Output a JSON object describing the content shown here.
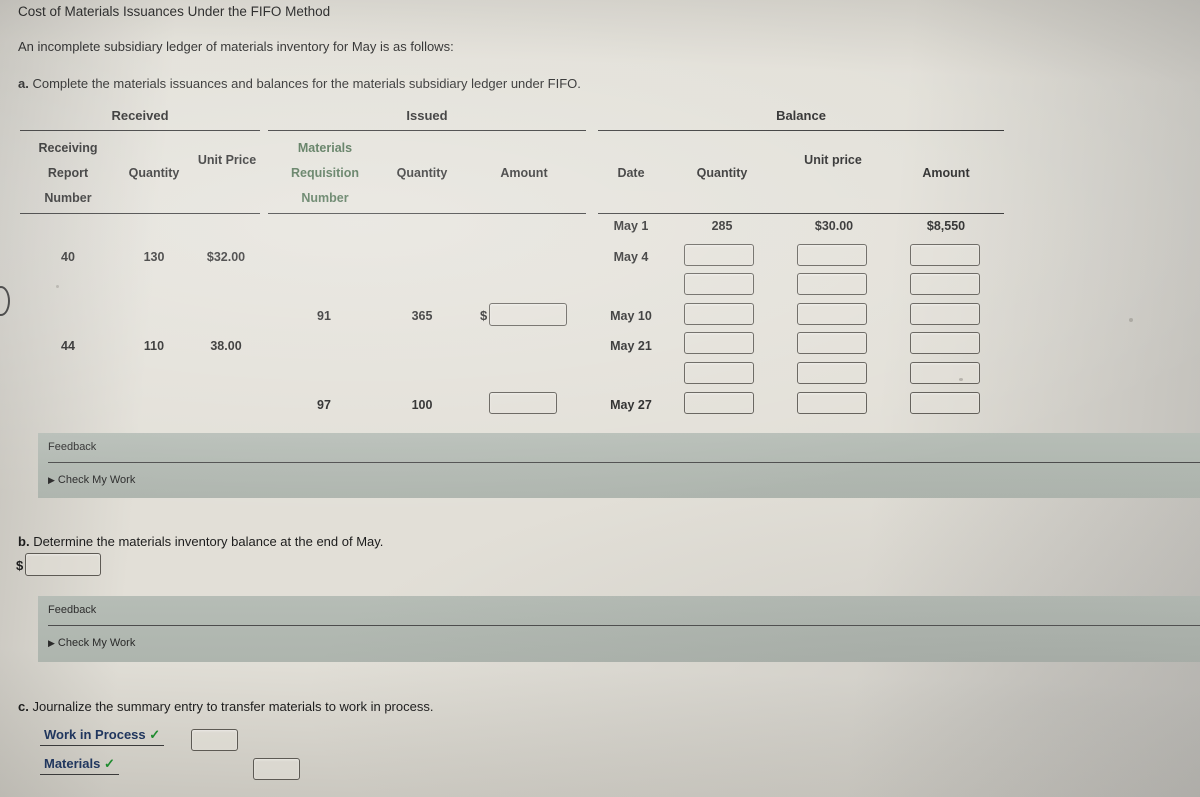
{
  "page": {
    "title": "Cost of Materials Issuances Under the FIFO Method",
    "intro": "An incomplete subsidiary ledger of materials inventory for May is as follows:"
  },
  "questions": {
    "a": {
      "label": "a.",
      "text": "Complete the materials issuances and balances for the materials subsidiary ledger under FIFO."
    },
    "b": {
      "label": "b.",
      "text": "Determine the materials inventory balance at the end of May.",
      "dollar": "$"
    },
    "c": {
      "label": "c.",
      "text": "Journalize the summary entry to transfer materials to work in process."
    }
  },
  "ledger": {
    "groups": [
      {
        "label": "Received"
      },
      {
        "label": "Issued"
      },
      {
        "label": "Balance"
      }
    ],
    "columns": {
      "received": [
        {
          "label": "Receiving Report Number"
        },
        {
          "label": "Quantity"
        },
        {
          "label": "Unit Price"
        }
      ],
      "issued": [
        {
          "label": "Materials Requisition Number",
          "color": "#3f6342"
        },
        {
          "label": "Quantity"
        },
        {
          "label": "Amount"
        }
      ],
      "balance": [
        {
          "label": "Date"
        },
        {
          "label": "Quantity"
        },
        {
          "label": "Unit price"
        },
        {
          "label": "Amount"
        }
      ]
    },
    "rows": [
      {
        "received": {
          "report": "",
          "quantity": "",
          "unit_price": ""
        },
        "issued": {
          "requisition": "",
          "quantity": "",
          "amount": ""
        },
        "balance": {
          "date": "May 1",
          "quantity": "285",
          "unit_price": "$30.00",
          "amount": "$8,550"
        }
      },
      {
        "received": {
          "report": "40",
          "quantity": "130",
          "unit_price": "$32.00"
        },
        "issued": {
          "requisition": "",
          "quantity": "",
          "amount": ""
        },
        "balance": {
          "date": "May 4",
          "quantity": "",
          "unit_price": "",
          "amount": ""
        }
      },
      {
        "received": {
          "report": "",
          "quantity": "",
          "unit_price": ""
        },
        "issued": {
          "requisition": "",
          "quantity": "",
          "amount": ""
        },
        "balance": {
          "date": "",
          "quantity": "",
          "unit_price": "",
          "amount": ""
        }
      },
      {
        "received": {
          "report": "",
          "quantity": "",
          "unit_price": ""
        },
        "issued": {
          "requisition": "91",
          "quantity": "365",
          "amount": "",
          "amount_prefix": "$"
        },
        "balance": {
          "date": "May 10",
          "quantity": "",
          "unit_price": "",
          "amount": ""
        }
      },
      {
        "received": {
          "report": "44",
          "quantity": "110",
          "unit_price": "38.00"
        },
        "issued": {
          "requisition": "",
          "quantity": "",
          "amount": ""
        },
        "balance": {
          "date": "May 21",
          "quantity": "",
          "unit_price": "",
          "amount": ""
        }
      },
      {
        "received": {
          "report": "",
          "quantity": "",
          "unit_price": ""
        },
        "issued": {
          "requisition": "",
          "quantity": "",
          "amount": ""
        },
        "balance": {
          "date": "",
          "quantity": "",
          "unit_price": "",
          "amount": ""
        }
      },
      {
        "received": {
          "report": "",
          "quantity": "",
          "unit_price": ""
        },
        "issued": {
          "requisition": "97",
          "quantity": "100",
          "amount": ""
        },
        "balance": {
          "date": "May 27",
          "quantity": "",
          "unit_price": "",
          "amount": ""
        }
      }
    ]
  },
  "feedback": {
    "title": "Feedback",
    "check_my_work": "Check My Work",
    "caret": "▶"
  },
  "journal": {
    "entries": [
      {
        "account": "Work in Process",
        "check": "✓",
        "debit": "",
        "credit": ""
      },
      {
        "account": "Materials",
        "check": "✓",
        "debit": "",
        "credit": ""
      }
    ]
  },
  "colors": {
    "page_bg": "#dedbd2",
    "rule": "#2a2a2a",
    "green_header": "#3f6342",
    "account_link": "#20365e",
    "check_green": "#1e8b2e",
    "feedback_bg": "#b1b8b1",
    "box_border": "#5d5a54"
  }
}
